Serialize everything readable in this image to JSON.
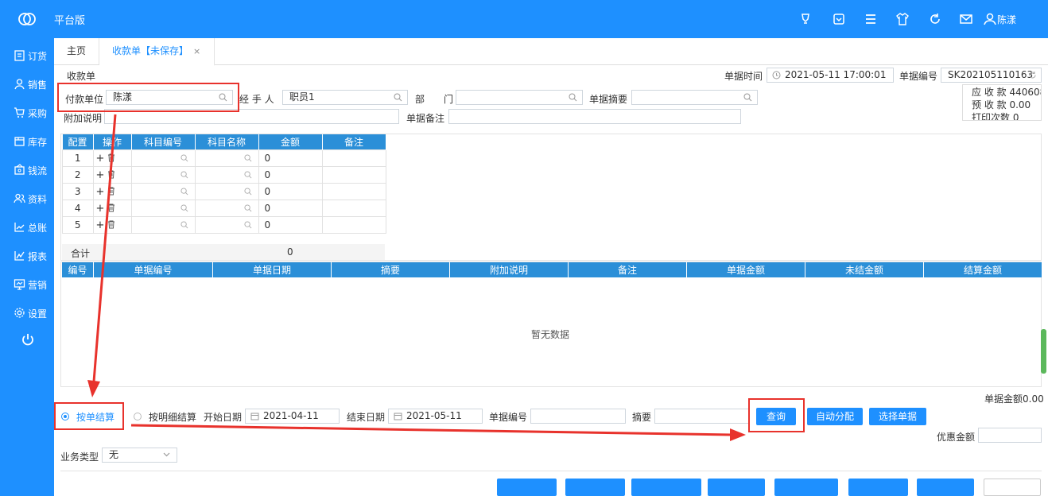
{
  "app": {
    "title": "平台版",
    "user": "陈漾"
  },
  "topbar_icons": [
    "bulb-icon",
    "download-icon",
    "menu-icon",
    "shirt-icon",
    "refresh-icon",
    "mail-icon",
    "user-icon"
  ],
  "sidebar": [
    {
      "label": "订货",
      "icon": "clipboard-icon"
    },
    {
      "label": "销售",
      "icon": "person-icon"
    },
    {
      "label": "采购",
      "icon": "cart-icon"
    },
    {
      "label": "库存",
      "icon": "box-icon"
    },
    {
      "label": "钱流",
      "icon": "wallet-icon"
    },
    {
      "label": "资料",
      "icon": "people-icon"
    },
    {
      "label": "总账",
      "icon": "chart-icon"
    },
    {
      "label": "报表",
      "icon": "report-icon"
    },
    {
      "label": "营销",
      "icon": "monitor-icon"
    },
    {
      "label": "设置",
      "icon": "gear-icon"
    }
  ],
  "tabs": {
    "home": "主页",
    "active": "收款单【未保存】",
    "close": "×"
  },
  "form": {
    "doc_label": "收款单",
    "time_label": "单据时间",
    "time_value": "2021-05-11 17:00:01",
    "no_label": "单据编号",
    "no_value": "SK202105110163",
    "payer_label": "付款单位",
    "payer_value": "陈漾",
    "handler_label": "经 手 人",
    "handler_value": "职员1",
    "dept_label": "部　　门",
    "dept_value": "",
    "abstract_label": "单据摘要",
    "abstract_value": "",
    "note_label": "附加说明",
    "note_value": "",
    "remark_label": "单据备注",
    "remark_value": ""
  },
  "summary": {
    "receivable": "应 收 款 440608.",
    "prepaid": "预 收 款 0.00",
    "prints": "打印次数 0"
  },
  "grid1": {
    "headers": [
      "配置",
      "操作",
      "科目编号",
      "科目名称",
      "金额",
      "备注"
    ],
    "rows": [
      {
        "no": "1",
        "amount": "0"
      },
      {
        "no": "2",
        "amount": "0"
      },
      {
        "no": "3",
        "amount": "0"
      },
      {
        "no": "4",
        "amount": "0"
      },
      {
        "no": "5",
        "amount": "0"
      }
    ],
    "total_label": "合计",
    "total_value": "0"
  },
  "grid2": {
    "headers": [
      "编号",
      "单据编号",
      "单据日期",
      "摘要",
      "附加说明",
      "备注",
      "单据金额",
      "未结金额",
      "结算金额"
    ],
    "empty": "暂无数据"
  },
  "settle": {
    "doc_amount": "单据金额0.00",
    "by_doc": "按单结算",
    "by_detail": "按明细结算",
    "start_label": "开始日期",
    "start_value": "2021-04-11",
    "end_label": "结束日期",
    "end_value": "2021-05-11",
    "docno_label": "单据编号",
    "docno_value": "",
    "abstract_label": "摘要",
    "abstract_value": "",
    "query": "查询",
    "auto_alloc": "自动分配",
    "select_doc": "选择单据",
    "discount_label": "优惠金额",
    "discount_value": "",
    "biz_type_label": "业务类型",
    "biz_type_value": "无"
  },
  "colors": {
    "brand": "#1e90ff",
    "header": "#2b8fd8",
    "annotation": "#e8322c"
  }
}
